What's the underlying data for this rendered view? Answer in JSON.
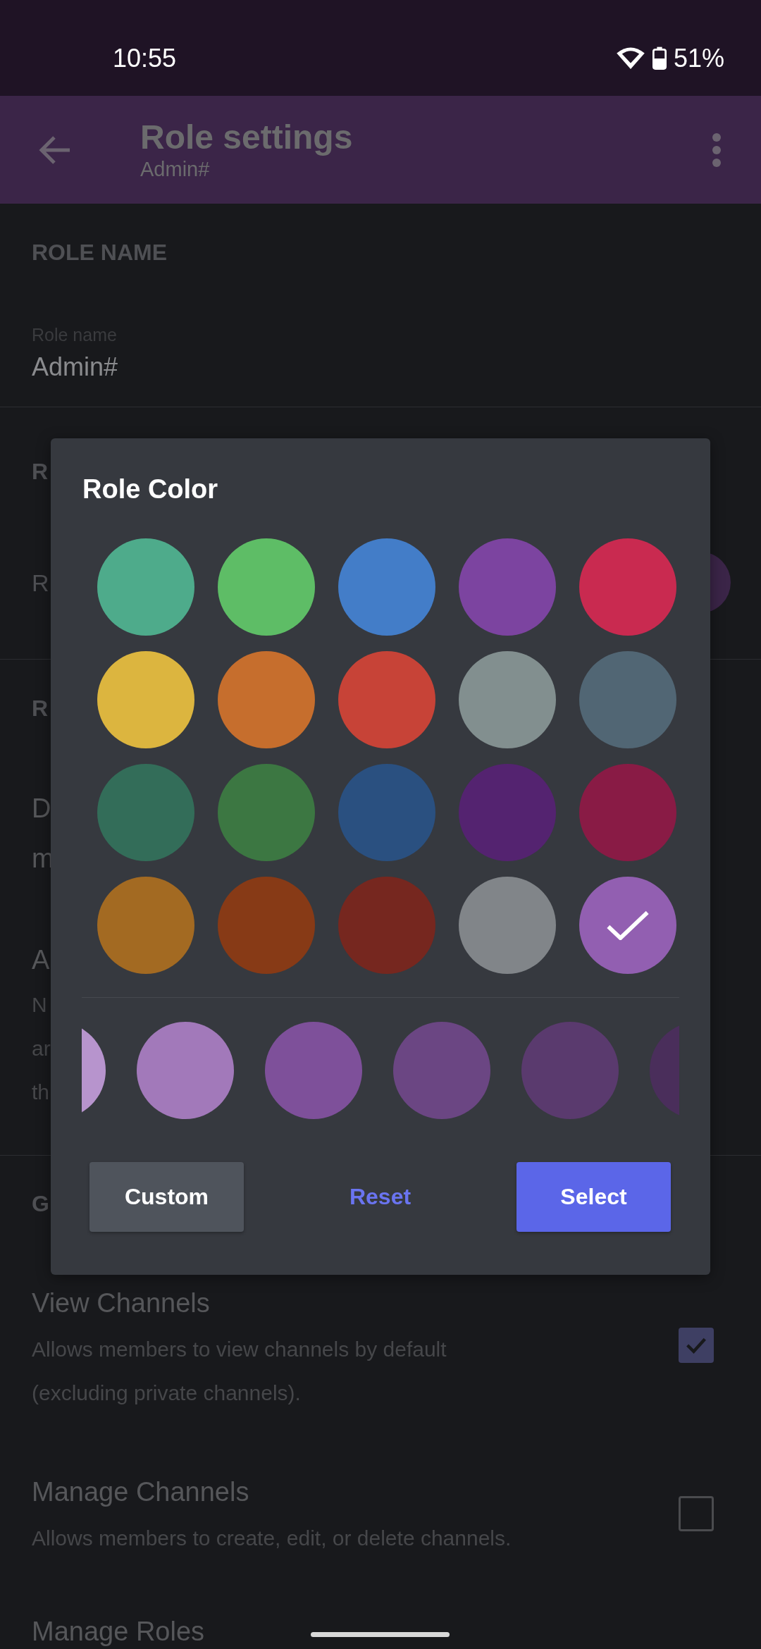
{
  "status_bar": {
    "time": "10:55",
    "battery": "51%"
  },
  "app_bar": {
    "title": "Role settings",
    "subtitle": "Admin#"
  },
  "role_name": {
    "heading": "ROLE NAME",
    "label": "Role name",
    "value": "Admin#"
  },
  "role_color": {
    "heading": "R",
    "row_label": "R"
  },
  "role_settings": {
    "heading": "R",
    "permissions": [
      {
        "title": [
          "D",
          "m"
        ]
      },
      {
        "title": [
          "A"
        ],
        "description": [
          "N",
          "ar",
          "th"
        ]
      }
    ]
  },
  "general": {
    "heading": "G",
    "permissions": [
      {
        "title": "View Channels",
        "description": [
          "Allows members to view channels by default",
          "(excluding private channels)."
        ],
        "checked": true
      },
      {
        "title": "Manage Channels",
        "description": [
          "Allows members to create, edit, or delete channels."
        ],
        "checked": false
      },
      {
        "title": "Manage Roles"
      }
    ]
  },
  "dialog": {
    "title": "Role Color",
    "swatches": [
      {
        "color": "#4eab8b",
        "selected": false
      },
      {
        "color": "#5ebd66",
        "selected": false
      },
      {
        "color": "#437dc8",
        "selected": false
      },
      {
        "color": "#7c44a0",
        "selected": false
      },
      {
        "color": "#c92a50",
        "selected": false
      },
      {
        "color": "#dcb53f",
        "selected": false
      },
      {
        "color": "#c66e2d",
        "selected": false
      },
      {
        "color": "#c74337",
        "selected": false
      },
      {
        "color": "#828f8f",
        "selected": false
      },
      {
        "color": "#516674",
        "selected": false
      },
      {
        "color": "#336d59",
        "selected": false
      },
      {
        "color": "#3c7742",
        "selected": false
      },
      {
        "color": "#2a5080",
        "selected": false
      },
      {
        "color": "#542370",
        "selected": false
      },
      {
        "color": "#891b45",
        "selected": false
      },
      {
        "color": "#a36a22",
        "selected": false
      },
      {
        "color": "#873a16",
        "selected": false
      },
      {
        "color": "#76271f",
        "selected": false
      },
      {
        "color": "#818589",
        "selected": false
      },
      {
        "color": "#925fb1",
        "selected": true
      }
    ],
    "shades": [
      {
        "color": "#b794cd"
      },
      {
        "color": "#a279ba"
      },
      {
        "color": "#7e509a"
      },
      {
        "color": "#6b4683"
      },
      {
        "color": "#5a3a6e"
      },
      {
        "color": "#4a2e5b"
      }
    ],
    "buttons": [
      {
        "label": "Custom",
        "kind": "secondary"
      },
      {
        "label": "Reset",
        "kind": "link"
      },
      {
        "label": "Select",
        "kind": "primary"
      }
    ]
  }
}
